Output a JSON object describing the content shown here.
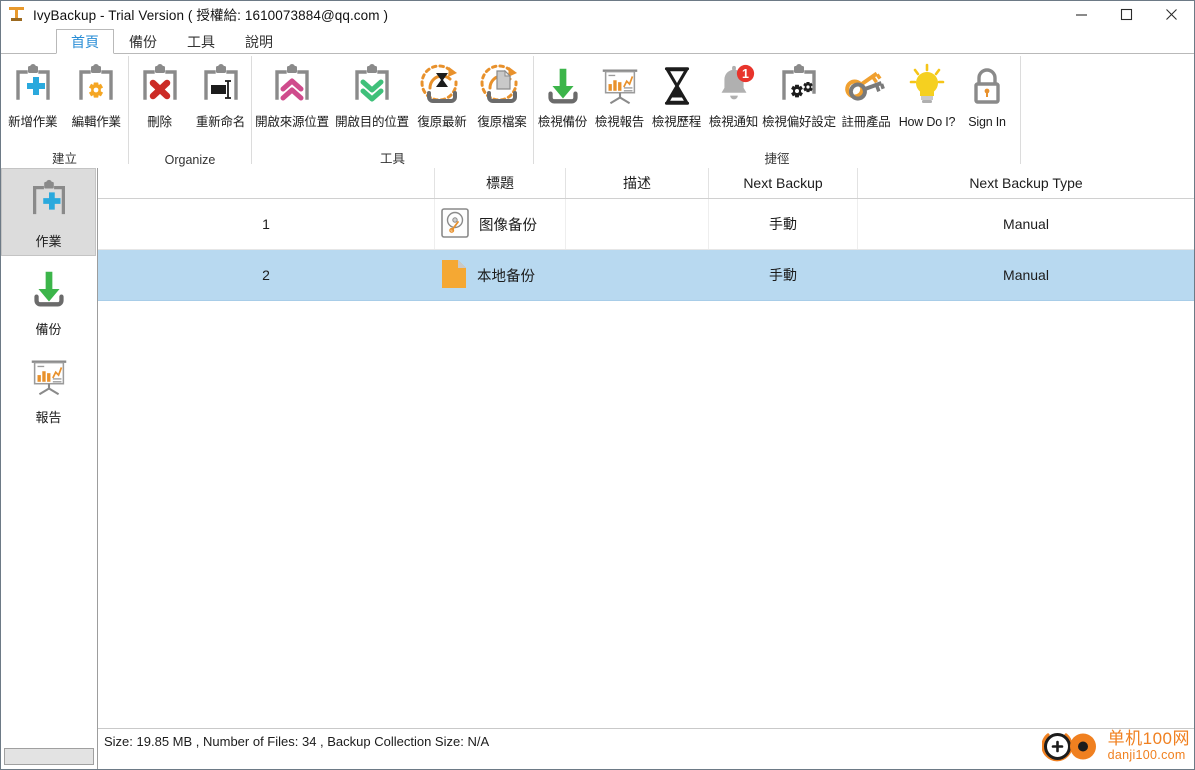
{
  "window": {
    "title": "IvyBackup - Trial Version ( 授權給: 1610073884@qq.com )",
    "app_icon": "ivybackup-logo-icon",
    "controls": {
      "minimize": "minimize-icon",
      "maximize": "maximize-icon",
      "close": "close-icon"
    }
  },
  "tabs": [
    {
      "label": "首頁",
      "active": true
    },
    {
      "label": "備份",
      "active": false
    },
    {
      "label": "工具",
      "active": false
    },
    {
      "label": "說明",
      "active": false
    }
  ],
  "ribbon": {
    "groups": [
      {
        "caption": "建立",
        "buttons": [
          {
            "label": "新增作業",
            "icon": "clipboard-plus-icon"
          },
          {
            "label": "編輯作業",
            "icon": "clipboard-gear-icon"
          }
        ]
      },
      {
        "caption": "Organize",
        "buttons": [
          {
            "label": "刪除",
            "icon": "clipboard-delete-icon"
          },
          {
            "label": "重新命名",
            "icon": "clipboard-rename-icon"
          }
        ]
      },
      {
        "caption": "工具",
        "buttons": [
          {
            "label": "開啟來源位置",
            "icon": "clipboard-up-arrows-icon"
          },
          {
            "label": "開啟目的位置",
            "icon": "clipboard-down-arrows-icon"
          },
          {
            "label": "復原最新",
            "icon": "restore-latest-hourglass-icon"
          },
          {
            "label": "復原檔案",
            "icon": "restore-file-icon"
          }
        ]
      },
      {
        "caption": "捷徑",
        "buttons": [
          {
            "label": "檢視備份",
            "icon": "download-tray-icon"
          },
          {
            "label": "檢視報告",
            "icon": "report-chart-board-icon"
          },
          {
            "label": "檢視歷程",
            "icon": "hourglass-icon"
          },
          {
            "label": "檢視通知",
            "icon": "bell-notification-icon",
            "badge": "1"
          },
          {
            "label": "檢視偏好設定",
            "icon": "clipboard-settings-icon"
          },
          {
            "label": "註冊產品",
            "icon": "keys-icon"
          },
          {
            "label": "How Do I?",
            "icon": "lightbulb-icon",
            "dropdown": true
          },
          {
            "label": "Sign In",
            "icon": "padlock-icon"
          }
        ]
      }
    ]
  },
  "sidebar": {
    "items": [
      {
        "label": "作業",
        "icon": "clipboard-plus-icon",
        "active": true
      },
      {
        "label": "備份",
        "icon": "download-tray-icon",
        "active": false
      },
      {
        "label": "報告",
        "icon": "report-chart-board-icon",
        "active": false
      }
    ]
  },
  "table": {
    "headers": {
      "num": "",
      "title": "標題",
      "description": "描述",
      "next_backup": "Next Backup",
      "next_backup_type": "Next Backup Type"
    },
    "rows": [
      {
        "num": "1",
        "icon": "hard-disk-icon",
        "title": "图像备份",
        "description": "",
        "next_backup": "手動",
        "next_backup_type": "Manual",
        "selected": false
      },
      {
        "num": "2",
        "icon": "orange-document-icon",
        "title": "本地备份",
        "description": "",
        "next_backup": "手動",
        "next_backup_type": "Manual",
        "selected": true
      }
    ]
  },
  "status": {
    "text": "Size: 19.85 MB , Number of Files: 34 , Backup Collection Size: N/A"
  },
  "watermark": {
    "cn": "单机100网",
    "en": "danji100.com",
    "icon": "danji100-logo-icon"
  },
  "colors": {
    "accent_blue": "#2a8ed6",
    "selection_blue": "#b8d9f0",
    "orange": "#f0a030",
    "green": "#3cb54a",
    "red": "#d9332c",
    "gray_icon": "#9e9e9e"
  }
}
